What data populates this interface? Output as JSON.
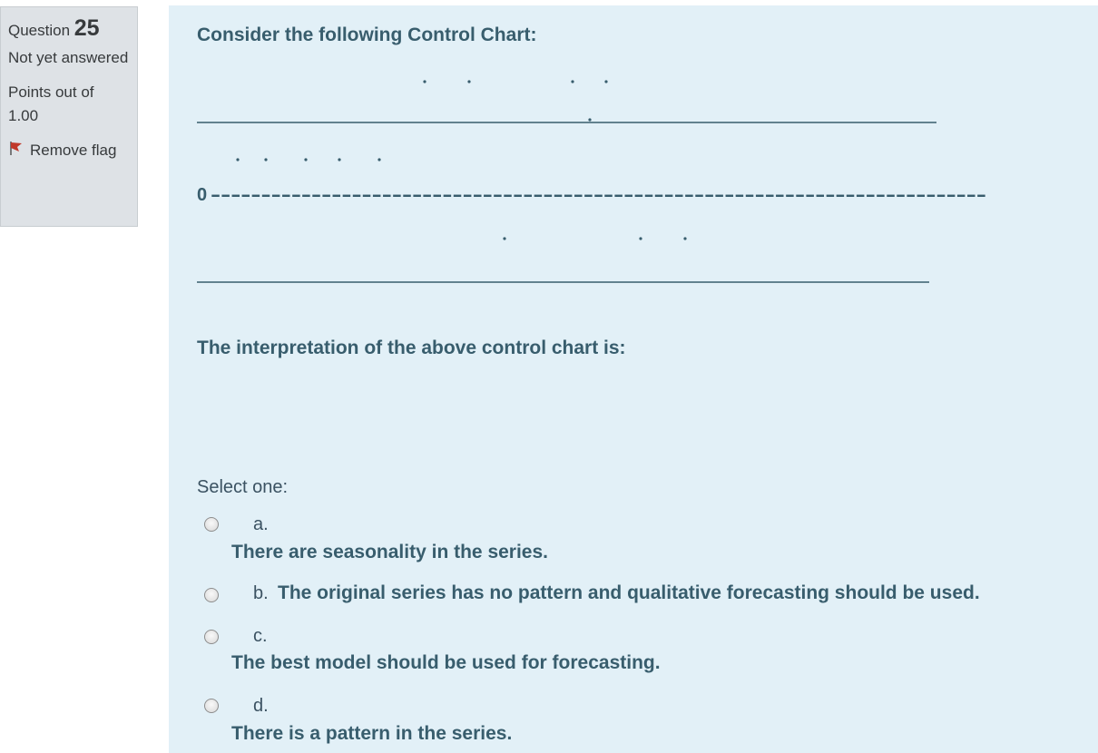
{
  "sidebar": {
    "question_label": "Question",
    "question_number": "25",
    "state": "Not yet answered",
    "grade_label": "Points out of",
    "grade_value": "1.00",
    "flag_label": "Remove flag"
  },
  "question": {
    "intro": "Consider the following Control Chart:",
    "chart": {
      "zero_label": "0",
      "zero_dashes": "-----------------------------------------------------------------------------",
      "upper_points_count": 5,
      "middle_points_count": 5,
      "lower_points_count": 3
    },
    "interpretation": "The interpretation of the above control chart is:",
    "prompt": "Select one:"
  },
  "options": [
    {
      "letter": "a.",
      "text": "There are seasonality in the series."
    },
    {
      "letter": "b.",
      "text": "The original series has no pattern and qualitative forecasting should be used."
    },
    {
      "letter": "c.",
      "text": "The best model should be used for forecasting."
    },
    {
      "letter": "d.",
      "text": "There is a pattern in the series."
    }
  ],
  "colors": {
    "content_bg": "#e2f0f7",
    "info_bg": "#dee2e6",
    "question_text": "#385d6d",
    "flag_red": "#c0392b"
  }
}
